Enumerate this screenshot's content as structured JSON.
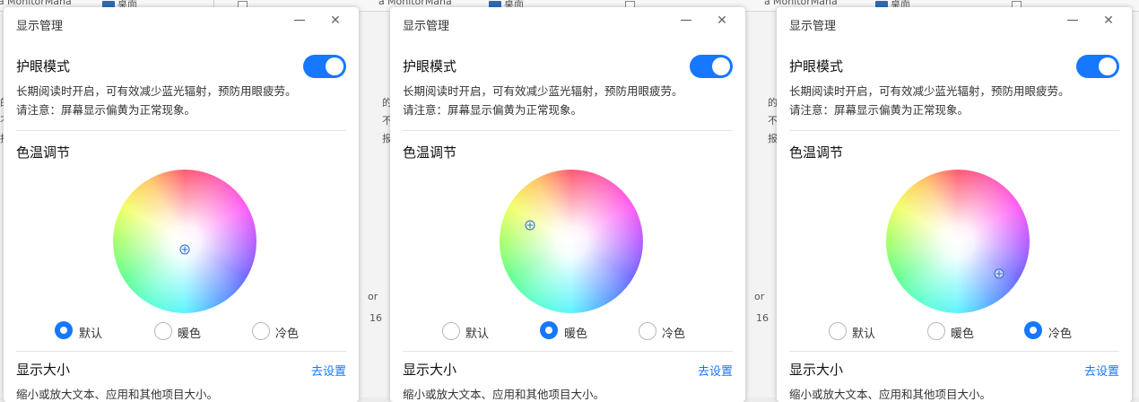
{
  "background": {
    "window_title_fragment": "MonitorMana",
    "title_prefix": "å°",
    "desktop_label": "桌面",
    "row_text": "or",
    "row_num": "16",
    "side_chars": [
      "的",
      "不",
      "报"
    ]
  },
  "panels": [
    {
      "title": "显示管理",
      "eye_care": {
        "heading": "护眼模式",
        "desc_line1": "长期阅读时开启，可有效减少蓝光辐射，预防用眼疲劳。",
        "desc_line2": "请注意：屏幕显示偏黄为正常现象。",
        "toggle_on": true
      },
      "color_temp": {
        "heading": "色温调节",
        "marker": "neutral",
        "options": [
          {
            "label": "默认",
            "selected": true
          },
          {
            "label": "暖色",
            "selected": false
          },
          {
            "label": "冷色",
            "selected": false
          }
        ]
      },
      "display_size": {
        "heading": "显示大小",
        "link_label": "去设置",
        "desc": "缩小或放大文本、应用和其他项目大小。"
      }
    },
    {
      "title": "显示管理",
      "eye_care": {
        "heading": "护眼模式",
        "desc_line1": "长期阅读时开启，可有效减少蓝光辐射，预防用眼疲劳。",
        "desc_line2": "请注意：屏幕显示偏黄为正常现象。",
        "toggle_on": true
      },
      "color_temp": {
        "heading": "色温调节",
        "marker": "warm",
        "options": [
          {
            "label": "默认",
            "selected": false
          },
          {
            "label": "暖色",
            "selected": true
          },
          {
            "label": "冷色",
            "selected": false
          }
        ]
      },
      "display_size": {
        "heading": "显示大小",
        "link_label": "去设置",
        "desc": "缩小或放大文本、应用和其他项目大小。"
      }
    },
    {
      "title": "显示管理",
      "eye_care": {
        "heading": "护眼模式",
        "desc_line1": "长期阅读时开启，可有效减少蓝光辐射，预防用眼疲劳。",
        "desc_line2": "请注意：屏幕显示偏黄为正常现象。",
        "toggle_on": true
      },
      "color_temp": {
        "heading": "色温调节",
        "marker": "cool",
        "options": [
          {
            "label": "默认",
            "selected": false
          },
          {
            "label": "暖色",
            "selected": false
          },
          {
            "label": "冷色",
            "selected": true
          }
        ]
      },
      "display_size": {
        "heading": "显示大小",
        "link_label": "去设置",
        "desc": "缩小或放大文本、应用和其他项目大小。"
      }
    }
  ],
  "colors": {
    "accent": "#1677ff",
    "panel_bg": "#ffffff",
    "text": "#222222"
  }
}
